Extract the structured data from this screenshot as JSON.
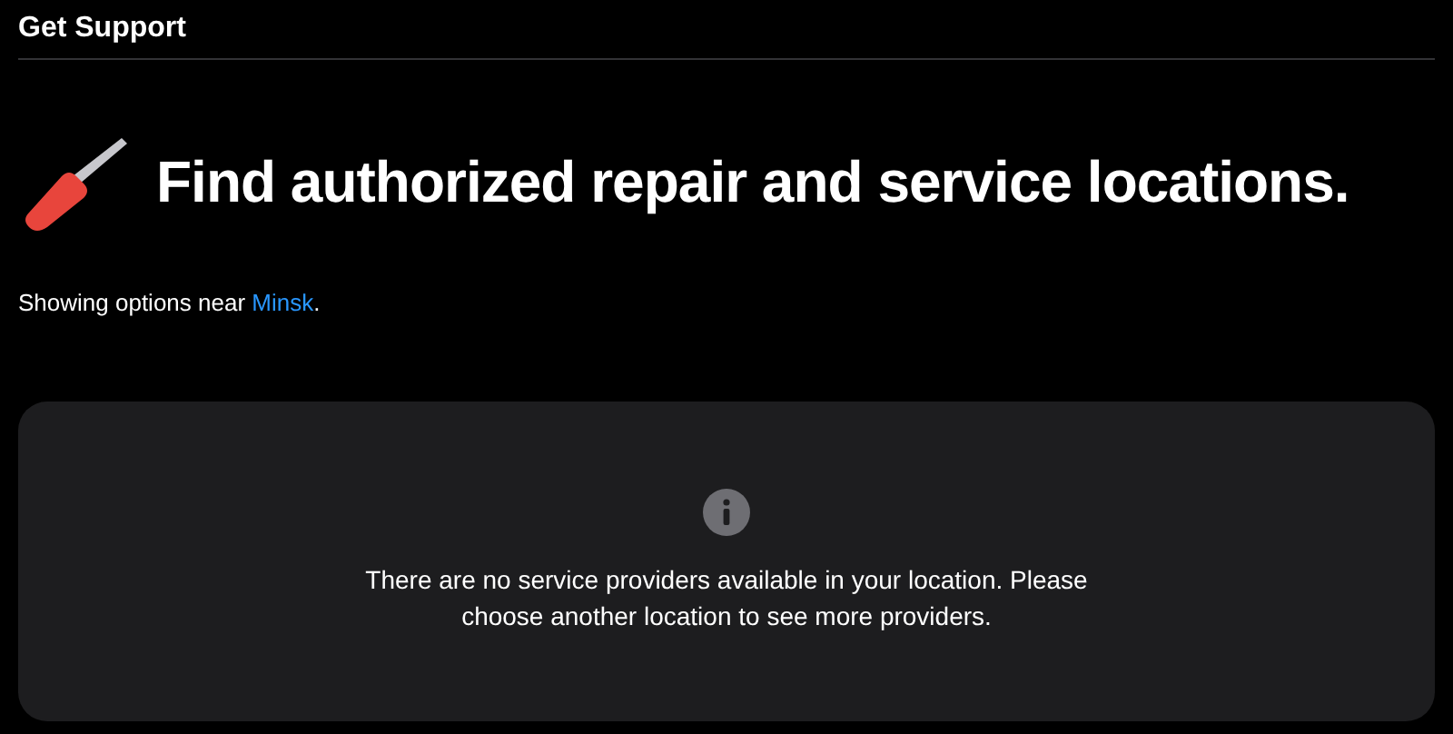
{
  "header": {
    "title": "Get Support"
  },
  "hero": {
    "heading": "Find authorized repair and service locations."
  },
  "location": {
    "prefix": "Showing options near ",
    "link": "Minsk",
    "suffix": "."
  },
  "notice": {
    "message": "There are no service providers available in your location. Please choose another location to see more providers."
  }
}
